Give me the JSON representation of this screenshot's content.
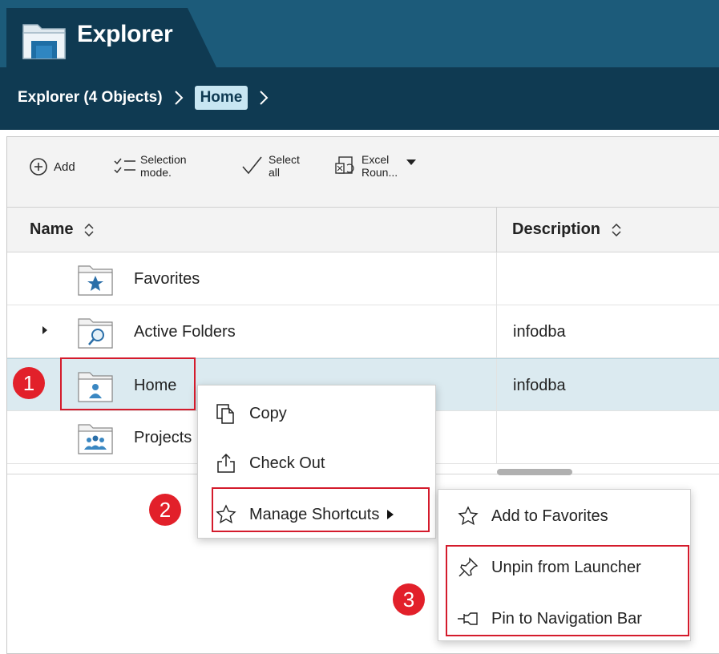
{
  "app": {
    "title": "Explorer",
    "breadcrumb": {
      "root": "Explorer (4 Objects)",
      "current": "Home"
    }
  },
  "toolbar": {
    "add": "Add",
    "selection_mode_1": "Selection",
    "selection_mode_2": "mode.",
    "select_all_1": "Select",
    "select_all_2": "all",
    "excel_1": "Excel",
    "excel_2": "Roun..."
  },
  "grid": {
    "columns": [
      "Name",
      "Description"
    ],
    "rows": [
      {
        "name": "Favorites",
        "description": ""
      },
      {
        "name": "Active Folders",
        "description": "infodba"
      },
      {
        "name": "Home",
        "description": "infodba"
      },
      {
        "name": "Projects",
        "description": ""
      }
    ]
  },
  "context_menu": {
    "items": [
      "Copy",
      "Check Out",
      "Manage Shortcuts"
    ]
  },
  "submenu": {
    "items": [
      "Add to Favorites",
      "Unpin from Launcher",
      "Pin to Navigation Bar"
    ]
  },
  "annotations": {
    "badges": [
      "1",
      "2",
      "3"
    ],
    "highlight_color": "#d41b2c",
    "badge_color": "#e2202a"
  },
  "colors": {
    "header_dark": "#0f3a52",
    "header_light": "#1c5b7a",
    "selected_row": "#dbeaf0"
  }
}
